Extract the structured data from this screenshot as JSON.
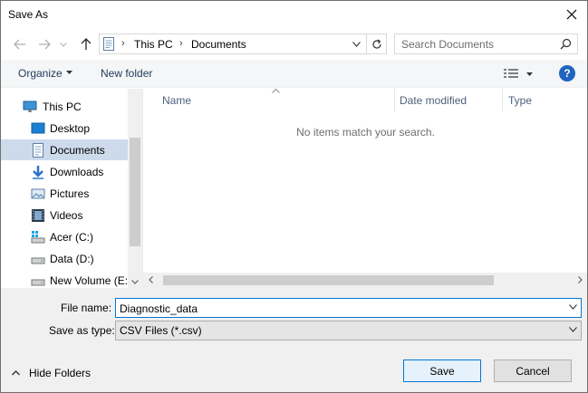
{
  "window": {
    "title": "Save As"
  },
  "nav": {
    "breadcrumbs": [
      "This PC",
      "Documents"
    ],
    "search_placeholder": "Search Documents"
  },
  "toolbar": {
    "organize": "Organize",
    "new_folder": "New folder",
    "help": "?"
  },
  "sidebar": {
    "items": [
      {
        "label": "This PC",
        "icon": "computer-icon",
        "selected": false
      },
      {
        "label": "Desktop",
        "icon": "desktop-icon",
        "selected": false
      },
      {
        "label": "Documents",
        "icon": "documents-icon",
        "selected": true
      },
      {
        "label": "Downloads",
        "icon": "download-arrow-icon",
        "selected": false
      },
      {
        "label": "Pictures",
        "icon": "pictures-icon",
        "selected": false
      },
      {
        "label": "Videos",
        "icon": "videos-icon",
        "selected": false
      },
      {
        "label": "Acer (C:)",
        "icon": "windows-drive-icon",
        "selected": false
      },
      {
        "label": "Data (D:)",
        "icon": "drive-icon",
        "selected": false
      },
      {
        "label": "New Volume (E:)",
        "icon": "drive-icon",
        "selected": false
      }
    ]
  },
  "filelist": {
    "columns": [
      "Name",
      "Date modified",
      "Type"
    ],
    "empty_message": "No items match your search."
  },
  "form": {
    "file_name_label": "File name:",
    "file_name_value": "Diagnostic_data",
    "save_type_label": "Save as type:",
    "save_type_value": "CSV Files (*.csv)"
  },
  "footer": {
    "hide_folders": "Hide Folders",
    "save": "Save",
    "cancel": "Cancel"
  },
  "colors": {
    "accent": "#0078d7",
    "selection": "#ccdaeb",
    "help": "#1f64c0"
  }
}
